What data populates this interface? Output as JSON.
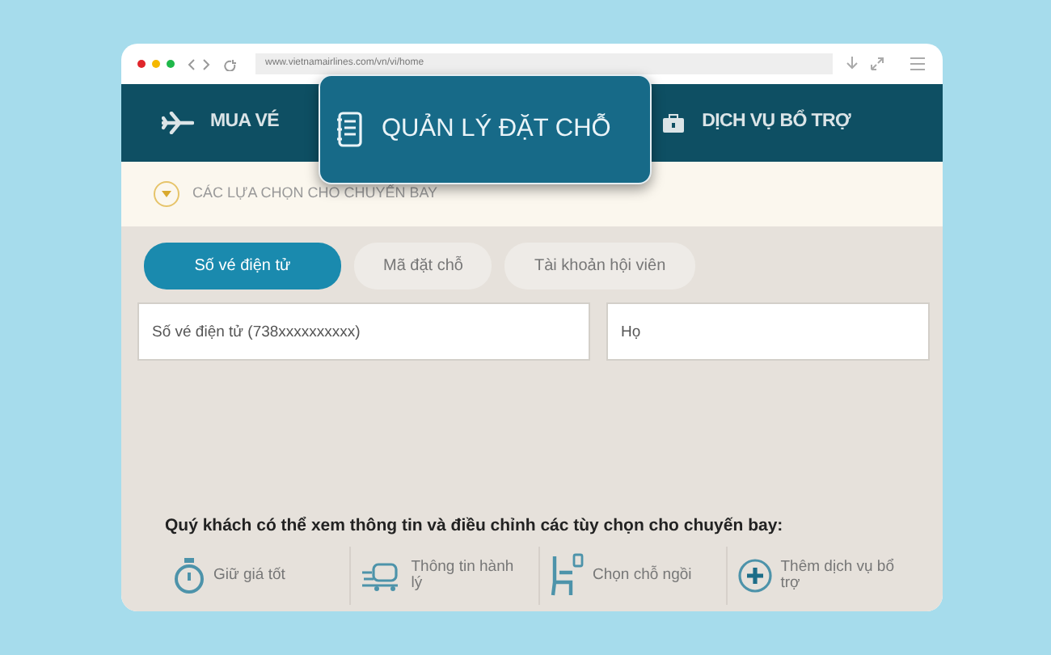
{
  "browser": {
    "url": "www.vietnamairlines.com/vn/vi/home"
  },
  "nav": {
    "items": [
      {
        "label": "MUA VÉ",
        "kind": "flights"
      },
      {
        "label": "DỊCH VỤ BỔ TRỢ",
        "kind": "services"
      }
    ]
  },
  "popup": {
    "label": "QUẢN LÝ ĐẶT CHỖ"
  },
  "options_bar": {
    "label": "CÁC LỰA CHỌN CHO CHUYẾN BAY"
  },
  "tabs": [
    {
      "label": "Số vé điện tử",
      "selected": true
    },
    {
      "label": "Mã đặt chỗ",
      "selected": false
    },
    {
      "label": "Tài khoản hội viên",
      "selected": false
    }
  ],
  "fields": [
    {
      "placeholder": "Số vé điện tử (738xxxxxxxxxx)"
    },
    {
      "placeholder": "Họ"
    }
  ],
  "info_text": "Quý khách có thể xem thông tin và điều chỉnh các tùy chọn cho chuyến bay:",
  "services": [
    {
      "label": "Giữ giá tốt",
      "kind": "hold"
    },
    {
      "label": "Thông tin hành lý",
      "kind": "baggage"
    },
    {
      "label": "Chọn chỗ ngồi",
      "kind": "seat"
    },
    {
      "label": "Thêm dịch vụ bổ trợ",
      "kind": "addon"
    }
  ]
}
